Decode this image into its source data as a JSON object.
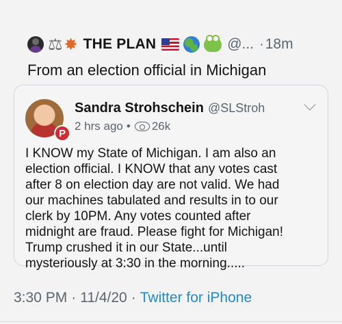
{
  "tweet": {
    "author_name": "THE PLAN",
    "author_handle": "@...",
    "separator": "·",
    "time_ago": "18m",
    "text": "From an election official in Michigan",
    "name_emoji_icons": [
      "avatar-emoji",
      "scales-icon",
      "collision-icon",
      "us-flag-icon",
      "globe-icon",
      "frog-icon"
    ]
  },
  "quoted": {
    "name": "Sandra Strohschein",
    "handle": "@SLStroh",
    "time_ago": "2 hrs ago",
    "separator": "•",
    "views": "26k",
    "badge": "P",
    "body_lines": [
      "I KNOW my State of Michigan. I am also an",
      "election official. I KNOW that any votes cast",
      "after 8 on election day are not valid. We had",
      "our machines tabulated and results in to our",
      "clerk by 10PM. Any votes counted after",
      "midnight are fraud. Please fight for Michigan!",
      "Trump crushed it in our State...until",
      "mysteriously at 3:30 in the morning....."
    ]
  },
  "footer": {
    "time": "3:30 PM",
    "date": "11/4/20",
    "separator": "·",
    "source": "Twitter for iPhone",
    "source_color": "#1d8ad6"
  }
}
